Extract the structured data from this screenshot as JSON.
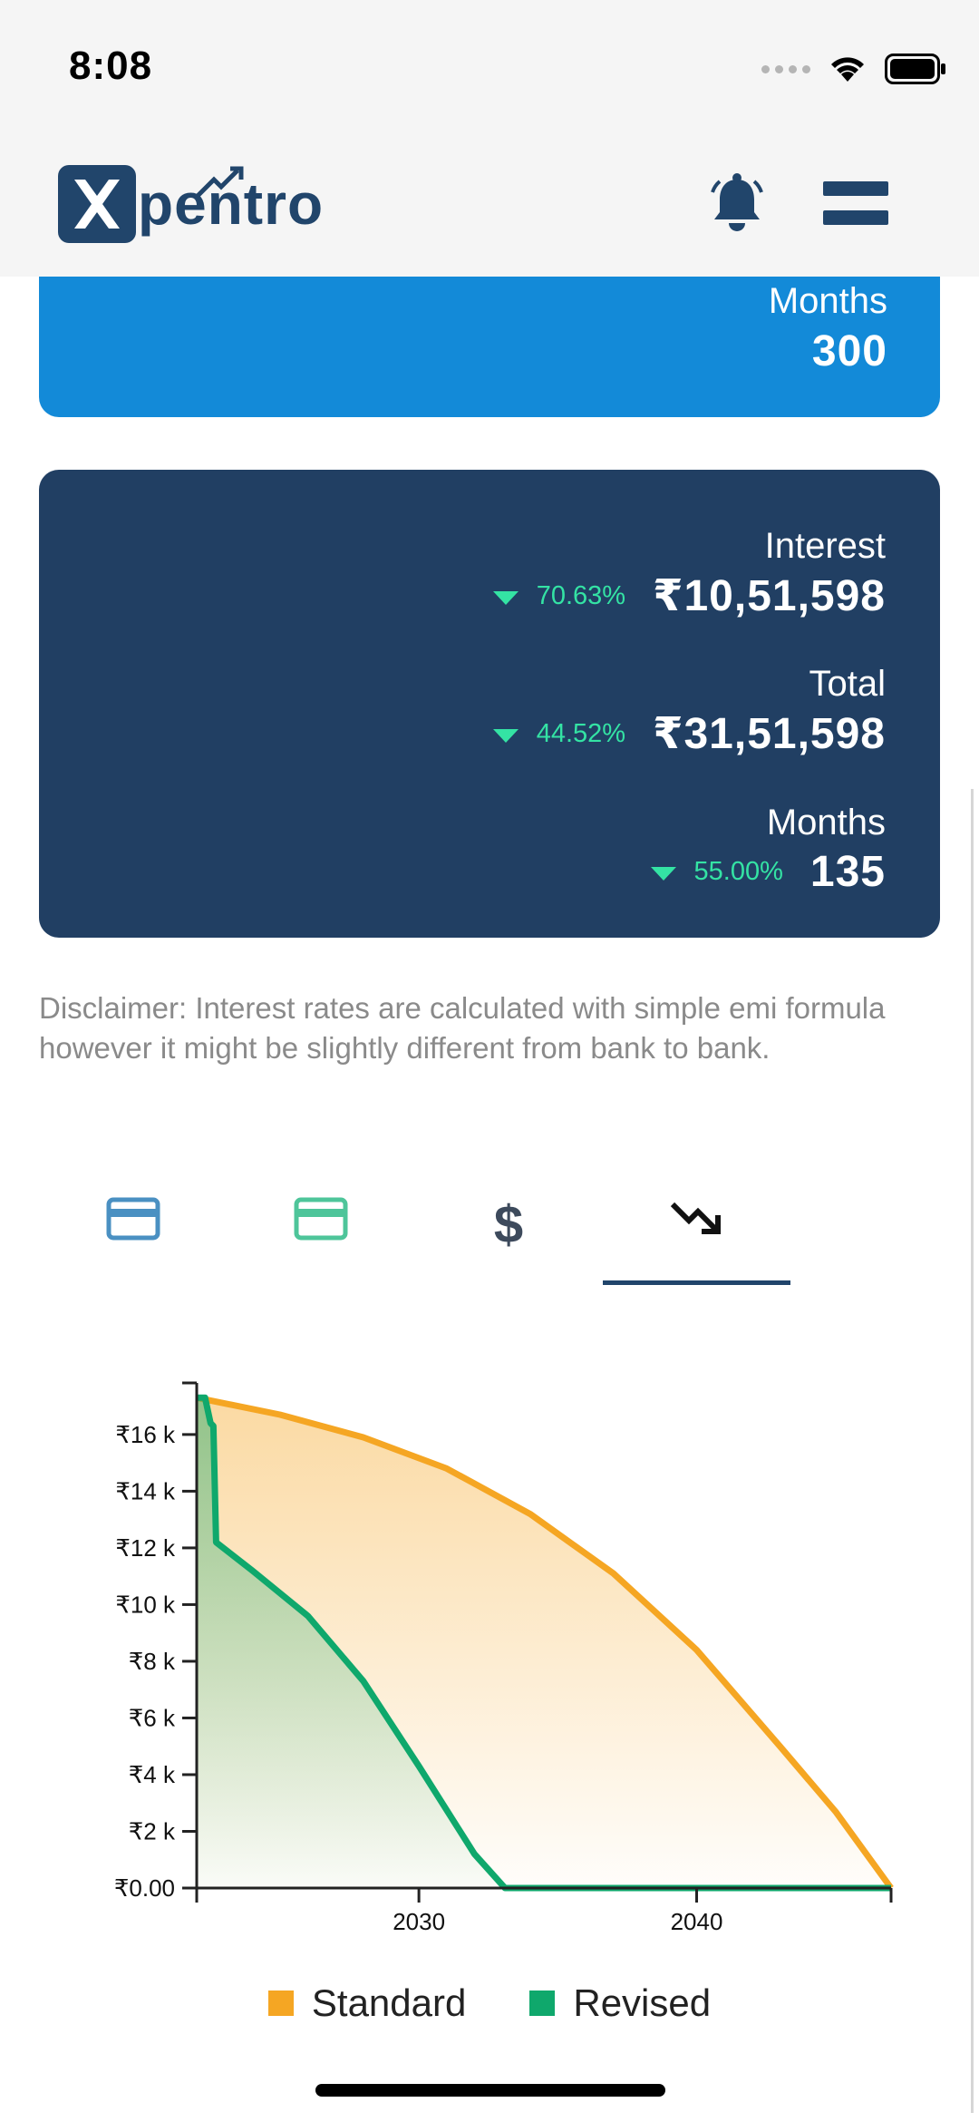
{
  "status_bar": {
    "time": "8:08"
  },
  "header": {
    "logo_text": "pentro",
    "icons": [
      "bell-icon",
      "menu-icon"
    ]
  },
  "loan_card": {
    "months_label": "Months",
    "months_value": "300"
  },
  "prepayment_card": {
    "interest": {
      "label": "Interest",
      "percent": "70.63%",
      "value": "₹10,51,598"
    },
    "total": {
      "label": "Total",
      "percent": "44.52%",
      "value": "₹31,51,598"
    },
    "months": {
      "label": "Months",
      "percent": "55.00%",
      "value": "135"
    }
  },
  "disclaimer": "Disclaimer: Interest rates are calculated with simple emi formula however it might be slightly different from bank to bank.",
  "tabs": [
    {
      "icon": "credit-card-icon",
      "color": "#4a90c2"
    },
    {
      "icon": "credit-card-icon",
      "color": "#4ec59a"
    },
    {
      "icon": "dollar-icon",
      "color": "#3d4a5c"
    },
    {
      "icon": "trending-down-icon",
      "color": "#111111",
      "active": true
    }
  ],
  "colors": {
    "brand_dark": "#213f63",
    "brand_blue": "#138ad8",
    "positive": "#34e3a4",
    "standard": "#f5a623",
    "revised": "#0fa86c"
  },
  "chart_data": {
    "type": "area",
    "title": "",
    "xlabel": "",
    "ylabel": "",
    "x_ticks": [
      "2030",
      "2040"
    ],
    "y_ticks": [
      "₹0.00",
      "₹2 k",
      "₹4 k",
      "₹6 k",
      "₹8 k",
      "₹10 k",
      "₹12 k",
      "₹14 k",
      "₹16 k"
    ],
    "xlim": [
      2022,
      2047
    ],
    "ylim": [
      0,
      17500
    ],
    "legend_position": "bottom",
    "series": [
      {
        "name": "Standard",
        "color": "#f5a623",
        "x": [
          2022,
          2025,
          2028,
          2031,
          2034,
          2037,
          2040,
          2043,
          2045,
          2047
        ],
        "y": [
          17300,
          16700,
          15900,
          14800,
          13200,
          11100,
          8400,
          5000,
          2700,
          0
        ]
      },
      {
        "name": "Revised",
        "color": "#0fa86c",
        "x": [
          2022,
          2022.3,
          2022.5,
          2022.6,
          2022.7,
          2024,
          2026,
          2028,
          2030,
          2032,
          2033.1,
          2047
        ],
        "y": [
          17300,
          17300,
          16400,
          16300,
          12200,
          11200,
          9600,
          7300,
          4300,
          1200,
          0,
          0
        ]
      }
    ]
  }
}
